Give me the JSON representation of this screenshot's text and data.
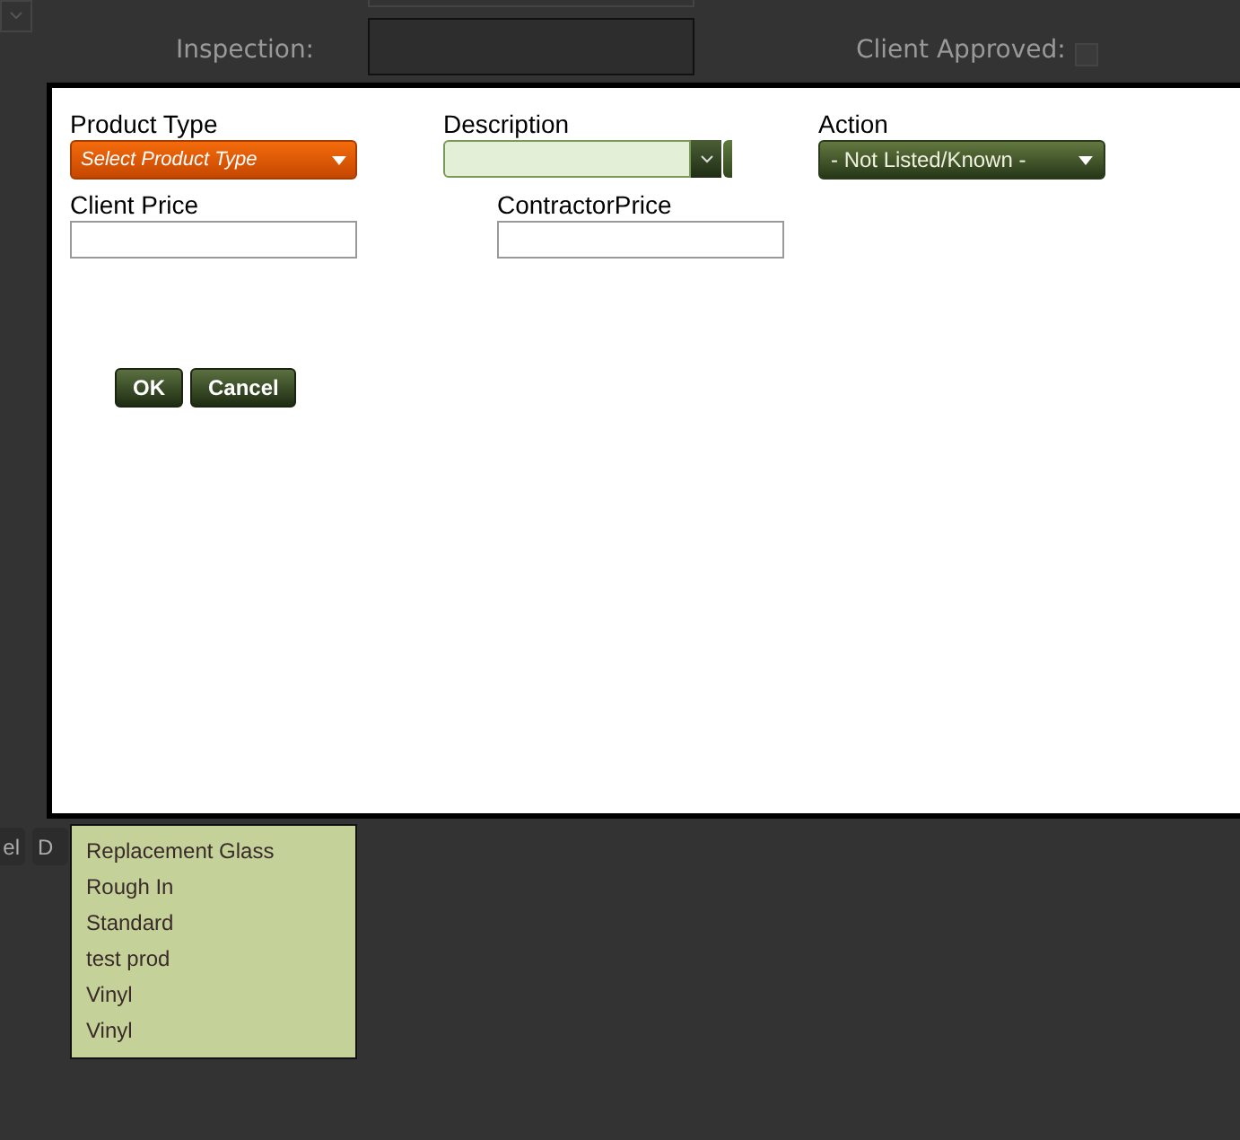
{
  "background": {
    "inspection_label": "Inspection:",
    "client_approved_label": "Client Approved:",
    "client_approved": false,
    "buttons": [
      "el",
      "D"
    ]
  },
  "dialog": {
    "product_type": {
      "label": "Product Type",
      "value": "Select Product Type"
    },
    "description": {
      "label": "Description"
    },
    "action": {
      "label": "Action",
      "value": "- Not Listed/Known -"
    },
    "client_price": {
      "label": "Client Price"
    },
    "contractor_price": {
      "label": "ContractorPrice"
    },
    "buttons": [
      "OK",
      "Cancel"
    ]
  },
  "dropdown_list": [
    "Replacement Glass",
    "Rough In",
    "Standard",
    "test prod",
    "Vinyl",
    "Vinyl"
  ]
}
